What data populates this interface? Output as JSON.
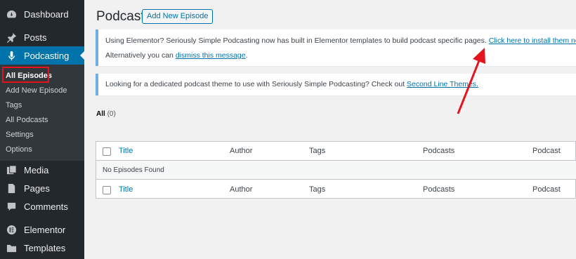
{
  "sidebar": {
    "menu": [
      {
        "label": "Dashboard",
        "icon": "dashboard-icon"
      },
      {
        "label": "Posts",
        "icon": "pin-icon"
      },
      {
        "label": "Podcasting",
        "icon": "microphone-icon"
      },
      {
        "label": "Media",
        "icon": "media-icon"
      },
      {
        "label": "Pages",
        "icon": "page-icon"
      },
      {
        "label": "Comments",
        "icon": "comment-icon"
      },
      {
        "label": "Elementor",
        "icon": "elementor-icon"
      },
      {
        "label": "Templates",
        "icon": "folder-icon"
      }
    ],
    "submenu": [
      "All Episodes",
      "Add New Episode",
      "Tags",
      "All Podcasts",
      "Settings",
      "Options"
    ]
  },
  "header": {
    "title": "Podcast",
    "add_new_label": "Add New Episode"
  },
  "notice1": {
    "text": "Using Elementor? Seriously Simple Podcasting now has built in Elementor templates to build podcast specific pages. ",
    "link": "Click here to install them now.",
    "text2": "Alternatively you can ",
    "link2": "dismiss this message",
    "end2": "."
  },
  "notice2": {
    "text": "Looking for a dedicated podcast theme to use with Seriously Simple Podcasting? Check out ",
    "link": "Second Line Themes."
  },
  "filter": {
    "label": "All",
    "count": "(0)"
  },
  "table": {
    "columns": [
      "Title",
      "Author",
      "Tags",
      "Podcasts",
      "Podcast"
    ],
    "empty_message": "No Episodes Found"
  },
  "colors": {
    "sidebar_bg": "#23282d",
    "active_bg": "#0073aa",
    "link": "#0073aa",
    "highlight": "#e3141d"
  }
}
